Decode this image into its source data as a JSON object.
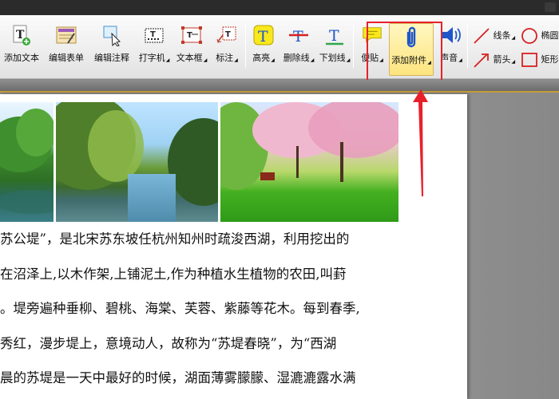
{
  "toolbar": {
    "tools": [
      {
        "label": "添加文本",
        "dropdown": false
      },
      {
        "label": "编辑表单",
        "dropdown": false
      },
      {
        "label": "编辑注释",
        "dropdown": false
      },
      {
        "label": "打字机",
        "dropdown": true
      },
      {
        "label": "文本框",
        "dropdown": true
      },
      {
        "label": "标注",
        "dropdown": true
      },
      {
        "label": "高亮",
        "dropdown": true
      },
      {
        "label": "删除线",
        "dropdown": true
      },
      {
        "label": "下划线",
        "dropdown": true
      },
      {
        "label": "便贴",
        "dropdown": true
      },
      {
        "label": "添加附件",
        "dropdown": true,
        "selected": true
      },
      {
        "label": "声音",
        "dropdown": true
      }
    ],
    "shapes": {
      "line": "线条",
      "ellipse": "椭圆",
      "arrow": "箭头",
      "rectangle": "矩形"
    }
  },
  "colors": {
    "accent": "#e8202a",
    "selected_tool_bg": "#fde47e",
    "highlight_yellow": "#f8e81c",
    "strike_red": "#d62020",
    "underline_blue": "#1e6fd9",
    "ruler_accent": "#c89a3a"
  },
  "document": {
    "lines": [
      "苏公堤”，是北宋苏东坡任杭州知州时疏浚西湖，利用挖出的",
      "在沼泽上,以木作架,上铺泥土,作为种植水生植物的农田,叫葑",
      "。堤旁遍种垂柳、碧桃、海棠、芙蓉、紫藤等花木。每到春季,",
      "秀红，漫步堤上，意境动人，故称为“苏堤春晓”，为“西湖",
      "晨的苏堤是一天中最好的时候，湖面薄雾朦朦、湿漉漉露水满"
    ]
  }
}
